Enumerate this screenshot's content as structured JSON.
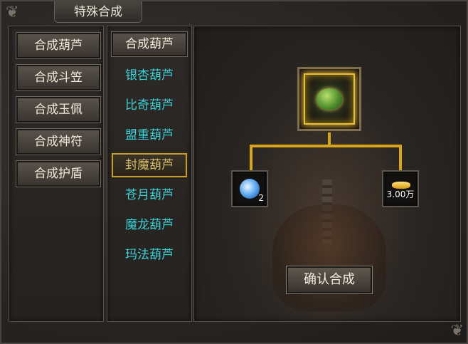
{
  "window": {
    "title": "特殊合成"
  },
  "categories": [
    {
      "label": "合成葫芦"
    },
    {
      "label": "合成斗笠"
    },
    {
      "label": "合成玉佩"
    },
    {
      "label": "合成神符"
    },
    {
      "label": "合成护盾"
    }
  ],
  "gourd_list": {
    "header": "合成葫芦",
    "items": [
      {
        "label": "银杏葫芦"
      },
      {
        "label": "比奇葫芦"
      },
      {
        "label": "盟重葫芦"
      },
      {
        "label": "封魔葫芦",
        "selected": true
      },
      {
        "label": "苍月葫芦"
      },
      {
        "label": "魔龙葫芦"
      },
      {
        "label": "玛法葫芦"
      }
    ]
  },
  "recipe": {
    "result_icon": "gourd-icon",
    "materials": [
      {
        "icon": "blue-gourd-icon",
        "quantity": "2"
      },
      {
        "icon": "gold-ingot-icon",
        "quantity": "3.00万"
      }
    ],
    "confirm_label": "确认合成"
  },
  "colors": {
    "accent_gold": "#d8a418",
    "item_cyan": "#3cd2d8",
    "selected_text": "#d8c068"
  }
}
